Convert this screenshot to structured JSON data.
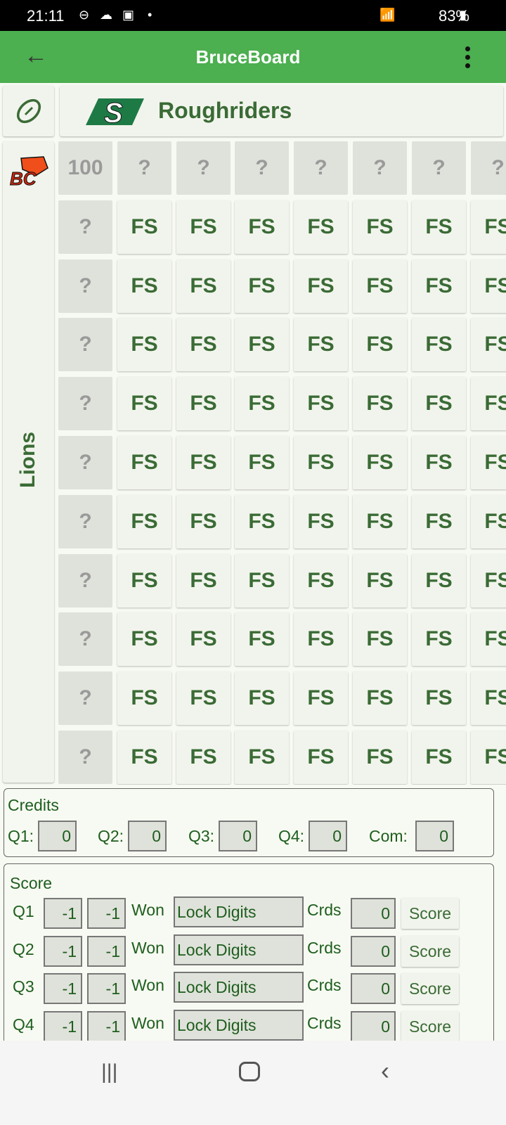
{
  "status_bar": {
    "time": "21:11",
    "battery": "83%"
  },
  "app_bar": {
    "title": "BruceBoard"
  },
  "top_team": {
    "name": "Roughriders"
  },
  "side_team": {
    "name": "Lions"
  },
  "grid": {
    "header_row": [
      "100",
      "?",
      "?",
      "?",
      "?",
      "?",
      "?",
      "?"
    ],
    "rows": [
      [
        "?",
        "FS",
        "FS",
        "FS",
        "FS",
        "FS",
        "FS",
        "FS"
      ],
      [
        "?",
        "FS",
        "FS",
        "FS",
        "FS",
        "FS",
        "FS",
        "FS"
      ],
      [
        "?",
        "FS",
        "FS",
        "FS",
        "FS",
        "FS",
        "FS",
        "FS"
      ],
      [
        "?",
        "FS",
        "FS",
        "FS",
        "FS",
        "FS",
        "FS",
        "FS"
      ],
      [
        "?",
        "FS",
        "FS",
        "FS",
        "FS",
        "FS",
        "FS",
        "FS"
      ],
      [
        "?",
        "FS",
        "FS",
        "FS",
        "FS",
        "FS",
        "FS",
        "FS"
      ],
      [
        "?",
        "FS",
        "FS",
        "FS",
        "FS",
        "FS",
        "FS",
        "FS"
      ],
      [
        "?",
        "FS",
        "FS",
        "FS",
        "FS",
        "FS",
        "FS",
        "FS"
      ],
      [
        "?",
        "FS",
        "FS",
        "FS",
        "FS",
        "FS",
        "FS",
        "FS"
      ],
      [
        "?",
        "FS",
        "FS",
        "FS",
        "FS",
        "FS",
        "FS",
        "FS"
      ]
    ]
  },
  "credits": {
    "title": "Credits",
    "fields": [
      {
        "label": "Q1:",
        "value": "0"
      },
      {
        "label": "Q2:",
        "value": "0"
      },
      {
        "label": "Q3:",
        "value": "0"
      },
      {
        "label": "Q4:",
        "value": "0"
      },
      {
        "label": "Com:",
        "value": "0"
      }
    ]
  },
  "score": {
    "title": "Score",
    "won_label": "Won",
    "crds_label": "Crds",
    "button_label": "Score",
    "rows": [
      {
        "q": "Q1",
        "a": "-1",
        "b": "-1",
        "winner": "Lock Digits",
        "crds": "0"
      },
      {
        "q": "Q2",
        "a": "-1",
        "b": "-1",
        "winner": "Lock Digits",
        "crds": "0"
      },
      {
        "q": "Q3",
        "a": "-1",
        "b": "-1",
        "winner": "Lock Digits",
        "crds": "0"
      },
      {
        "q": "Q4",
        "a": "-1",
        "b": "-1",
        "winner": "Lock Digits",
        "crds": "0"
      }
    ]
  },
  "colors": {
    "app_bar": "#4caf50",
    "team_text": "#3a6b35",
    "lions_orange": "#f04e1a"
  }
}
